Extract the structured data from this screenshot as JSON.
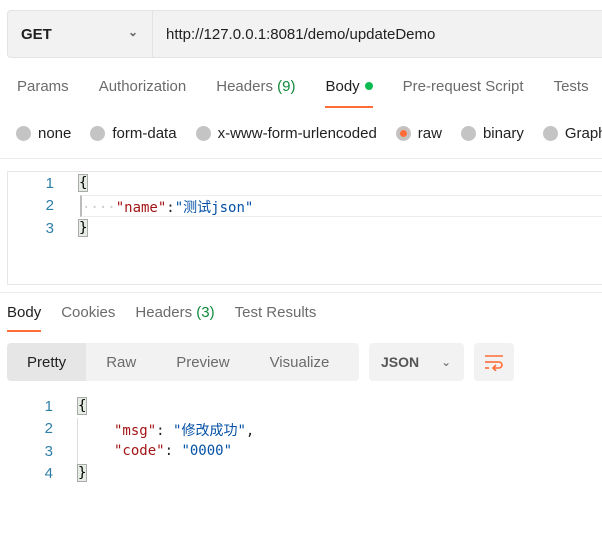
{
  "request": {
    "method": "GET",
    "url": "http://127.0.0.1:8081/demo/updateDemo"
  },
  "request_tabs": [
    {
      "label": "Params"
    },
    {
      "label": "Authorization"
    },
    {
      "label": "Headers",
      "count": "(9)"
    },
    {
      "label": "Body",
      "active": true
    },
    {
      "label": "Pre-request Script"
    },
    {
      "label": "Tests"
    }
  ],
  "body_types": [
    {
      "label": "none"
    },
    {
      "label": "form-data"
    },
    {
      "label": "x-www-form-urlencoded"
    },
    {
      "label": "raw",
      "selected": true
    },
    {
      "label": "binary"
    },
    {
      "label": "GraphQL"
    }
  ],
  "request_body": {
    "line_numbers": [
      "1",
      "2",
      "3"
    ],
    "open": "{",
    "indent": "····",
    "key": "\"name\"",
    "colon": ":",
    "value": "\"测试json\"",
    "close": "}"
  },
  "response_tabs": [
    {
      "label": "Body",
      "active": true
    },
    {
      "label": "Cookies"
    },
    {
      "label": "Headers",
      "count": "(3)"
    },
    {
      "label": "Test Results"
    }
  ],
  "view_modes": [
    "Pretty",
    "Raw",
    "Preview",
    "Visualize"
  ],
  "active_view": "Pretty",
  "language": "JSON",
  "response_body": {
    "line_numbers": [
      "1",
      "2",
      "3",
      "4"
    ],
    "open": "{",
    "msg_key": "\"msg\"",
    "msg_value": "\"修改成功\"",
    "code_key": "\"code\"",
    "code_value": "\"0000\"",
    "close": "}"
  },
  "colors": {
    "accent": "#ff6c37",
    "active_dot": "#0cbb52",
    "count": "#0f8a3b"
  }
}
